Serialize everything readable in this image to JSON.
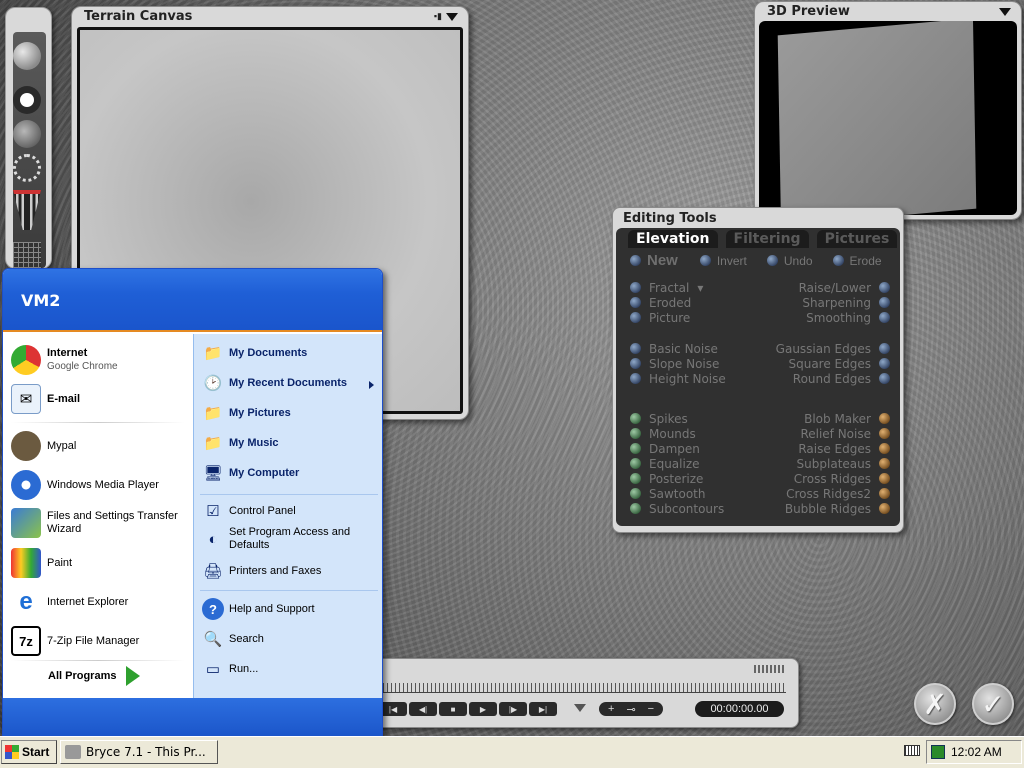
{
  "canvas": {
    "title": "Terrain Canvas"
  },
  "preview": {
    "title": "3D Preview"
  },
  "editing": {
    "title": "Editing Tools",
    "tabs": [
      "Elevation",
      "Filtering",
      "Pictures"
    ],
    "top_row": [
      "New",
      "Invert",
      "Undo",
      "Erode"
    ],
    "left_group1": [
      "Fractal",
      "Eroded",
      "Picture"
    ],
    "right_group1": [
      "Raise/Lower",
      "Sharpening",
      "Smoothing"
    ],
    "left_group2": [
      "Basic Noise",
      "Slope Noise",
      "Height Noise"
    ],
    "right_group2": [
      "Gaussian Edges",
      "Square Edges",
      "Round Edges"
    ],
    "left_group3": [
      "Spikes",
      "Mounds",
      "Dampen",
      "Equalize",
      "Posterize",
      "Sawtooth",
      "Subcontours"
    ],
    "right_group3": [
      "Blob Maker",
      "Relief Noise",
      "Raise Edges",
      "Subplateaus",
      "Cross Ridges",
      "Cross Ridges2",
      "Bubble Ridges"
    ]
  },
  "timeline": {
    "time": "00:00:00.00",
    "plus": "+",
    "minus": "−"
  },
  "startmenu": {
    "user": "VM2",
    "pinned": [
      {
        "title": "Internet",
        "sub": "Google Chrome"
      },
      {
        "title": "E-mail",
        "sub": ""
      }
    ],
    "recent": [
      "Mypal",
      "Windows Media Player",
      "Files and Settings Transfer Wizard",
      "Paint",
      "Internet Explorer",
      "7-Zip File Manager"
    ],
    "all_programs": "All Programs",
    "right": {
      "my_documents": "My Documents",
      "my_recent_documents": "My Recent Documents",
      "my_pictures": "My Pictures",
      "my_music": "My Music",
      "my_computer": "My Computer",
      "control_panel": "Control Panel",
      "set_program_access": "Set Program Access and Defaults",
      "printers": "Printers and Faxes",
      "help": "Help and Support",
      "search": "Search",
      "run": "Run..."
    }
  },
  "taskbar": {
    "start": "Start",
    "task": "Bryce 7.1 - This Pr...",
    "clock": "12:02 AM"
  }
}
